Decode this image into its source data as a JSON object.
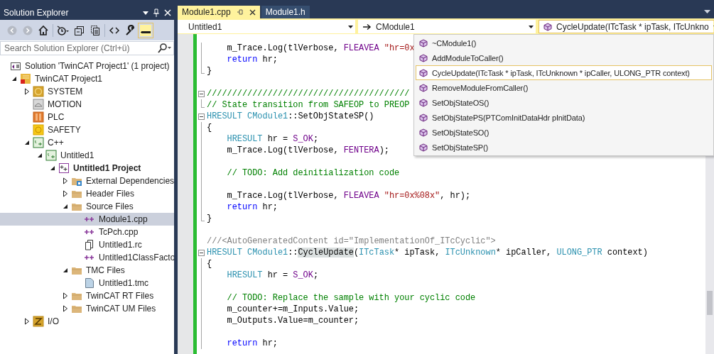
{
  "solution_explorer": {
    "title": "Solution Explorer",
    "toolbar": [
      {
        "buttons": [
          {
            "kind": "back",
            "disabled": true,
            "on": false
          },
          {
            "kind": "forward",
            "disabled": true,
            "on": false
          },
          {
            "kind": "home",
            "disabled": false,
            "on": false
          }
        ]
      },
      {
        "buttons": [
          {
            "kind": "history",
            "disabled": false,
            "on": false
          },
          {
            "kind": "collapse",
            "disabled": false,
            "on": false
          },
          {
            "kind": "copies",
            "disabled": false,
            "on": false
          }
        ]
      },
      {
        "buttons": [
          {
            "kind": "code",
            "disabled": false,
            "on": false
          },
          {
            "kind": "properties",
            "disabled": false,
            "on": false
          },
          {
            "kind": "preview",
            "disabled": false,
            "on": true
          }
        ]
      }
    ],
    "search": {
      "placeholder": "Search Solution Explorer (Ctrl+ü)"
    },
    "solution": {
      "label": "Solution 'TwinCAT Project1' (1 project)",
      "selected": false
    },
    "tree": [
      {
        "label": "TwinCAT Project1",
        "kind": "twincat",
        "expanded": true,
        "selected": false,
        "children": [
          {
            "label": "SYSTEM",
            "kind": "system",
            "expanded": false,
            "selected": false
          },
          {
            "label": "MOTION",
            "kind": "motion",
            "selected": false
          },
          {
            "label": "PLC",
            "kind": "plc",
            "selected": false
          },
          {
            "label": "SAFETY",
            "kind": "safety",
            "selected": false
          },
          {
            "label": "C++",
            "kind": "cpp",
            "expanded": true,
            "selected": false,
            "children": [
              {
                "label": "Untitled1",
                "kind": "cpp",
                "expanded": true,
                "selected": false,
                "children": [
                  {
                    "label": "Untitled1 Project",
                    "kind": "vcproject",
                    "expanded": true,
                    "selected": false,
                    "bold": true,
                    "children": [
                      {
                        "label": "External Dependencies",
                        "kind": "folder-ref",
                        "expanded": false,
                        "selected": false
                      },
                      {
                        "label": "Header Files",
                        "kind": "folder",
                        "expanded": false,
                        "selected": false
                      },
                      {
                        "label": "Source Files",
                        "kind": "folder",
                        "expanded": true,
                        "selected": false,
                        "children": [
                          {
                            "label": "Module1.cpp",
                            "kind": "cpp-file",
                            "selected": true
                          },
                          {
                            "label": "TcPch.cpp",
                            "kind": "cpp-file",
                            "selected": false
                          },
                          {
                            "label": "Untitled1.rc",
                            "kind": "rc-file",
                            "selected": false
                          },
                          {
                            "label": "Untitled1ClassFacto",
                            "kind": "cpp-file",
                            "selected": false
                          }
                        ]
                      },
                      {
                        "label": "TMC Files",
                        "kind": "folder",
                        "expanded": true,
                        "selected": false,
                        "children": [
                          {
                            "label": "Untitled1.tmc",
                            "kind": "tmc-file",
                            "selected": false
                          }
                        ]
                      },
                      {
                        "label": "TwinCAT RT Files",
                        "kind": "folder",
                        "expanded": false,
                        "selected": false
                      },
                      {
                        "label": "TwinCAT UM Files",
                        "kind": "folder",
                        "expanded": false,
                        "selected": false
                      }
                    ]
                  }
                ]
              }
            ]
          },
          {
            "label": "I/O",
            "kind": "io",
            "expanded": false,
            "selected": false
          }
        ]
      }
    ]
  },
  "editor": {
    "tabs": [
      {
        "label": "Module1.cpp",
        "selected": true
      },
      {
        "label": "Module1.h",
        "selected": false
      }
    ],
    "navigation": [
      {
        "text": "Untitled1",
        "kind": "project",
        "selected": false
      },
      {
        "text": "CModule1",
        "kind": "class",
        "selected": false
      },
      {
        "text": "CycleUpdate(ITcTask * ipTask, ITcUnkno",
        "kind": "method",
        "selected": true
      }
    ],
    "member_list": {
      "items": [
        {
          "label": "~CModule1()",
          "selected": false
        },
        {
          "label": "AddModuleToCaller()",
          "selected": false
        },
        {
          "label": "CycleUpdate(ITcTask * ipTask, ITcUnknown * ipCaller, ULONG_PTR context)",
          "selected": true
        },
        {
          "label": "RemoveModuleFromCaller()",
          "selected": false
        },
        {
          "label": "SetObjStateOS()",
          "selected": false
        },
        {
          "label": "SetObjStatePS(PTComInitDataHdr pInitData)",
          "selected": false
        },
        {
          "label": "SetObjStateSO()",
          "selected": false
        },
        {
          "label": "SetObjStateSP()",
          "selected": false
        }
      ]
    },
    "code": [
      {
        "kind": "fold-inside",
        "segments": [
          {
            "text": "    m_Trace.Log(tlVerbose, ",
            "kind": "plain"
          },
          {
            "text": "FLEAVEA ",
            "kind": "macro"
          },
          {
            "text": "\"hr=0x",
            "kind": "string"
          }
        ]
      },
      {
        "kind": "fold-inside",
        "segments": [
          {
            "text": "    return",
            "kind": "keyword"
          },
          {
            "text": " hr;",
            "kind": "plain"
          }
        ]
      },
      {
        "kind": "fold-end",
        "segments": [
          {
            "text": "}",
            "kind": "plain"
          }
        ]
      },
      {
        "kind": "blank"
      },
      {
        "kind": "fold-start",
        "segments": [
          {
            "text": "////////////////////////////////////////",
            "kind": "comment"
          }
        ]
      },
      {
        "kind": "fold-end",
        "segments": [
          {
            "text": "// State transition from SAFEOP to PREOP",
            "kind": "comment"
          }
        ]
      },
      {
        "kind": "fold-start",
        "segments": [
          {
            "text": "HRESULT CModule1",
            "kind": "type"
          },
          {
            "text": "::SetObjStateSP()",
            "kind": "plain"
          }
        ]
      },
      {
        "kind": "fold-inside",
        "segments": [
          {
            "text": "{",
            "kind": "plain"
          }
        ]
      },
      {
        "kind": "fold-inside",
        "segments": [
          {
            "text": "    HRESULT",
            "kind": "type"
          },
          {
            "text": " hr = ",
            "kind": "plain"
          },
          {
            "text": "S_OK",
            "kind": "macro"
          },
          {
            "text": ";",
            "kind": "plain"
          }
        ]
      },
      {
        "kind": "fold-inside",
        "segments": [
          {
            "text": "    m_Trace.Log(tlVerbose, ",
            "kind": "plain"
          },
          {
            "text": "FENTERA",
            "kind": "macro"
          },
          {
            "text": ");",
            "kind": "plain"
          }
        ]
      },
      {
        "kind": "fold-inside"
      },
      {
        "kind": "fold-inside",
        "segments": [
          {
            "text": "    // TODO: Add deinitialization code",
            "kind": "comment"
          }
        ]
      },
      {
        "kind": "fold-inside"
      },
      {
        "kind": "fold-inside",
        "segments": [
          {
            "text": "    m_Trace.Log(tlVerbose, ",
            "kind": "plain"
          },
          {
            "text": "FLEAVEA ",
            "kind": "macro"
          },
          {
            "text": "\"hr=0x%08x\"",
            "kind": "string"
          },
          {
            "text": ", hr);",
            "kind": "plain"
          }
        ]
      },
      {
        "kind": "fold-inside",
        "segments": [
          {
            "text": "    return",
            "kind": "keyword"
          },
          {
            "text": " hr;",
            "kind": "plain"
          }
        ]
      },
      {
        "kind": "fold-end",
        "segments": [
          {
            "text": "}",
            "kind": "plain"
          }
        ]
      },
      {
        "kind": "blank"
      },
      {
        "kind": "plain",
        "segments": [
          {
            "text": "///<AutoGeneratedContent id=\"ImplementationOf_ITcCyclic\">",
            "kind": "doc"
          }
        ]
      },
      {
        "kind": "fold-start",
        "segments": [
          {
            "text": "HRESULT CModule1",
            "kind": "type"
          },
          {
            "text": "::",
            "kind": "plain"
          },
          {
            "text": "CycleUpdate",
            "kind": "highlight"
          },
          {
            "text": "(",
            "kind": "plain"
          },
          {
            "text": "ITcTask",
            "kind": "type"
          },
          {
            "text": "* ipTask, ",
            "kind": "plain"
          },
          {
            "text": "ITcUnknown",
            "kind": "type"
          },
          {
            "text": "* ipCaller, ",
            "kind": "plain"
          },
          {
            "text": "ULONG_PTR",
            "kind": "type"
          },
          {
            "text": " context)",
            "kind": "plain"
          }
        ]
      },
      {
        "kind": "fold-inside",
        "segments": [
          {
            "text": "{",
            "kind": "plain"
          }
        ]
      },
      {
        "kind": "fold-inside",
        "segments": [
          {
            "text": "    HRESULT",
            "kind": "type"
          },
          {
            "text": " hr = ",
            "kind": "plain"
          },
          {
            "text": "S_OK",
            "kind": "macro"
          },
          {
            "text": ";",
            "kind": "plain"
          }
        ]
      },
      {
        "kind": "fold-inside"
      },
      {
        "kind": "fold-inside",
        "segments": [
          {
            "text": "    // TODO: Replace the sample with your cyclic code",
            "kind": "comment"
          }
        ]
      },
      {
        "kind": "fold-inside",
        "segments": [
          {
            "text": "    m_counter+=m_Inputs.Value;",
            "kind": "plain"
          }
        ]
      },
      {
        "kind": "fold-inside",
        "segments": [
          {
            "text": "    m_Outputs.Value=m_counter;",
            "kind": "plain"
          }
        ]
      },
      {
        "kind": "fold-inside"
      },
      {
        "kind": "fold-inside",
        "segments": [
          {
            "text": "    return",
            "kind": "keyword"
          },
          {
            "text": " hr;",
            "kind": "plain"
          }
        ]
      }
    ]
  }
}
